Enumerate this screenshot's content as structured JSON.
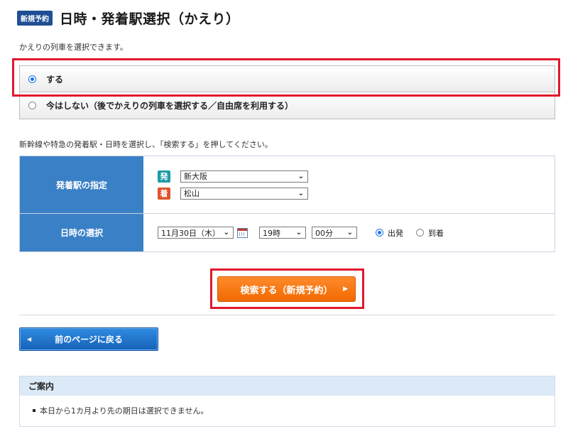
{
  "header": {
    "badge": "新規予約",
    "title": "日時・発着駅選択（かえり）"
  },
  "intro_text": "かえりの列車を選択できます。",
  "return_options": [
    {
      "label": "する",
      "selected": true
    },
    {
      "label": "今はしない（後でかえりの列車を選択する／自由席を利用する）",
      "selected": false
    }
  ],
  "instruction_text": "新幹線や特急の発着駅・日時を選択し、「検索する」を押してください。",
  "station_row": {
    "label": "発着駅の指定",
    "departure_tag": "発",
    "departure_station": "新大阪",
    "arrival_tag": "着",
    "arrival_station": "松山"
  },
  "datetime_row": {
    "label": "日時の選択",
    "date": "11月30日（木）",
    "hour": "19時",
    "minute": "00分",
    "direction_options": [
      {
        "label": "出発",
        "selected": true
      },
      {
        "label": "到着",
        "selected": false
      }
    ]
  },
  "search_button": "検索する（新規予約）",
  "back_button": "前のページに戻る",
  "notice": {
    "title": "ご案内",
    "items": [
      "本日から1カ月より先の期日は選択できません。"
    ]
  },
  "colors": {
    "accent_blue": "#3a80c6",
    "search_orange": "#f06a00",
    "highlight_red": "#e0182d",
    "departure_tag": "#1f9ba6",
    "arrival_tag": "#e0532c"
  },
  "icons": {
    "calendar": "calendar-icon",
    "dropdown": "chevron-down-icon",
    "next": "arrow-right-icon",
    "back": "arrow-left-icon"
  }
}
